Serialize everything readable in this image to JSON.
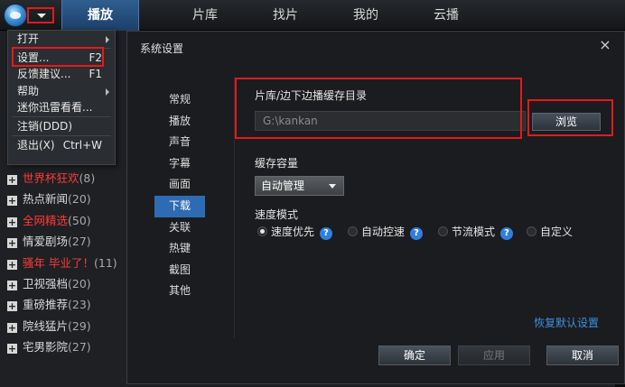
{
  "topbar": {
    "tabs": [
      "播放",
      "片库",
      "找片",
      "我的",
      "云播"
    ]
  },
  "menu": {
    "items": [
      {
        "label": "打开",
        "shortcut": "",
        "sub": true
      },
      {
        "label": "设置...",
        "shortcut": "F2",
        "sub": false
      },
      {
        "label": "反馈建议...",
        "shortcut": "F1",
        "sub": false
      },
      {
        "label": "帮助",
        "shortcut": "",
        "sub": true
      },
      {
        "label": "迷你迅雷看看...",
        "shortcut": "",
        "sub": false
      },
      {
        "label": "注销(DDD)",
        "shortcut": "",
        "sub": false
      },
      {
        "label": "退出(X)",
        "shortcut": "Ctrl+W",
        "sub": false
      }
    ]
  },
  "left_list": [
    {
      "name": "世界杯狂欢",
      "count": "(8)",
      "highlight": true
    },
    {
      "name": "热点新闻",
      "count": "(20)",
      "highlight": false
    },
    {
      "name": "全网精选",
      "count": "(50)",
      "highlight": true
    },
    {
      "name": "情爱剧场",
      "count": "(27)",
      "highlight": false
    },
    {
      "name": "骚年 毕业了！",
      "count": "(11)",
      "highlight": true
    },
    {
      "name": "卫视强档",
      "count": "(20)",
      "highlight": false
    },
    {
      "name": "重磅推荐",
      "count": "(23)",
      "highlight": false
    },
    {
      "name": "院线猛片",
      "count": "(29)",
      "highlight": false
    },
    {
      "name": "宅男影院",
      "count": "(27)",
      "highlight": false
    }
  ],
  "dialog": {
    "title": "系统设置",
    "close_icon": "×",
    "nav": [
      "常规",
      "播放",
      "声音",
      "字幕",
      "画面",
      "下载",
      "关联",
      "热键",
      "截图",
      "其他"
    ],
    "active_nav": "下载",
    "cache_dir_label": "片库/边下边播缓存目录",
    "cache_dir_value": "G:\\kankan",
    "browse_label": "浏览",
    "capacity_label": "缓存容量",
    "capacity_value": "自动管理",
    "speed_label": "速度模式",
    "speed_options": [
      {
        "label": "速度优先",
        "selected": true
      },
      {
        "label": "自动控速",
        "selected": false
      },
      {
        "label": "节流模式",
        "selected": false
      },
      {
        "label": "自定义",
        "selected": false
      }
    ],
    "restore_label": "恢复默认设置",
    "ok_label": "确定",
    "apply_label": "应用",
    "cancel_label": "取消"
  },
  "colors": {
    "accent": "#2e6bb5",
    "highlight_box": "#e41a1a",
    "red_text": "#ff3a3a",
    "link": "#3d8fe0"
  }
}
